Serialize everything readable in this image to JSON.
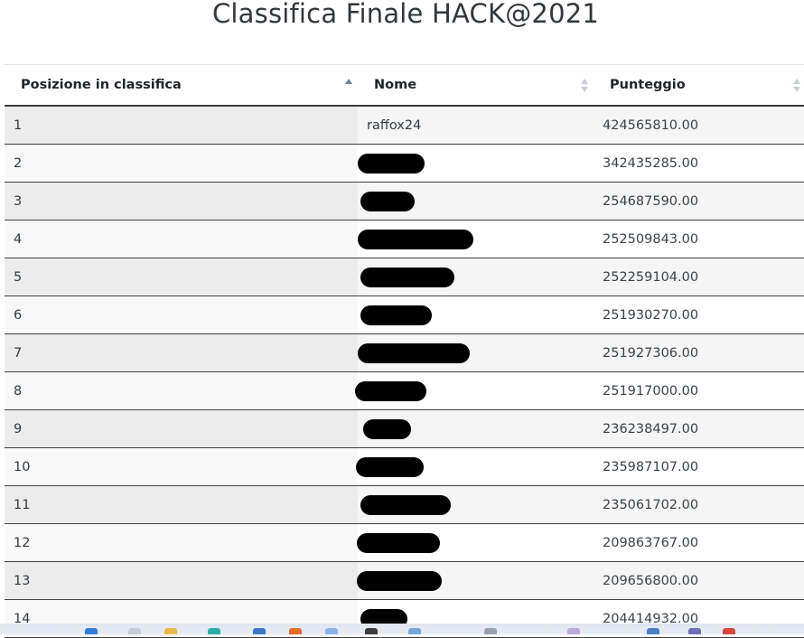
{
  "title": "Classifica Finale HACK@2021",
  "table": {
    "headers": {
      "position": "Posizione in classifica",
      "name": "Nome",
      "score": "Punteggio"
    },
    "rows": [
      {
        "pos": "1",
        "name": "raffox24",
        "score": "424565810.00",
        "redacted": false
      },
      {
        "pos": "2",
        "name": "",
        "score": "342435285.00",
        "redacted": true
      },
      {
        "pos": "3",
        "name": "",
        "score": "254687590.00",
        "redacted": true
      },
      {
        "pos": "4",
        "name": "",
        "score": "252509843.00",
        "redacted": true
      },
      {
        "pos": "5",
        "name": "",
        "score": "252259104.00",
        "redacted": true
      },
      {
        "pos": "6",
        "name": "",
        "score": "251930270.00",
        "redacted": true
      },
      {
        "pos": "7",
        "name": "",
        "score": "251927306.00",
        "redacted": true
      },
      {
        "pos": "8",
        "name": "",
        "score": "251917000.00",
        "redacted": true
      },
      {
        "pos": "9",
        "name": "",
        "score": "236238497.00",
        "redacted": true
      },
      {
        "pos": "10",
        "name": "",
        "score": "235987107.00",
        "redacted": true
      },
      {
        "pos": "11",
        "name": "",
        "score": "235061702.00",
        "redacted": true
      },
      {
        "pos": "12",
        "name": "",
        "score": "209863767.00",
        "redacted": true
      },
      {
        "pos": "13",
        "name": "",
        "score": "209656800.00",
        "redacted": true
      },
      {
        "pos": "14",
        "name": "",
        "score": "204414932.00",
        "redacted": true
      }
    ]
  },
  "colors": {
    "header_text": "#212529",
    "redaction": "#000000",
    "sort_active": "#6f7fa8",
    "sort_inactive": "#c9ced6"
  }
}
